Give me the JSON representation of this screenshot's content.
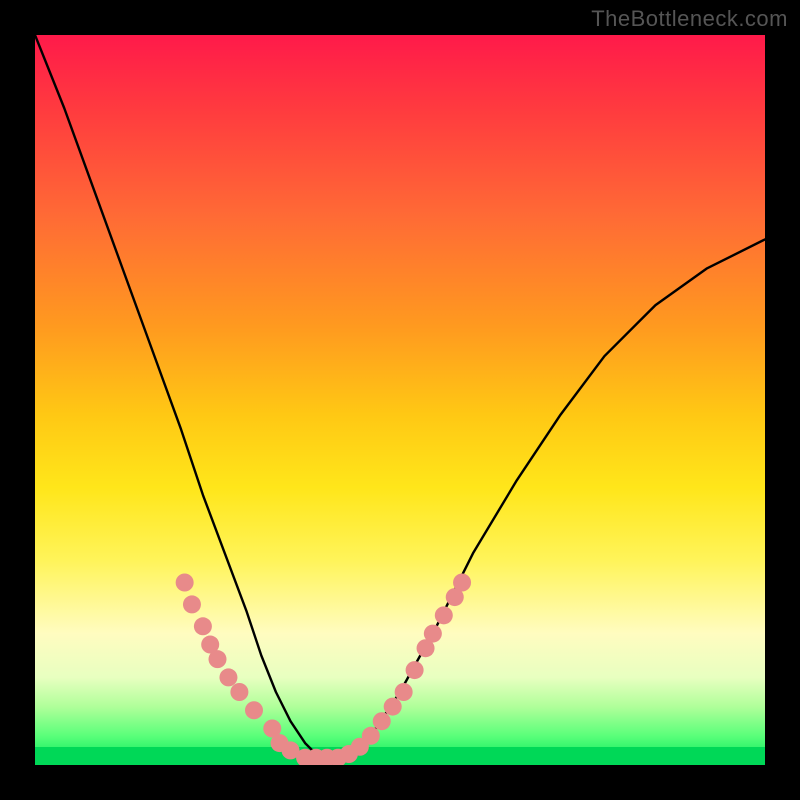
{
  "attribution": "TheBottleneck.com",
  "chart_data": {
    "type": "line",
    "title": "",
    "xlabel": "",
    "ylabel": "",
    "xlim": [
      0,
      100
    ],
    "ylim": [
      0,
      100
    ],
    "grid": false,
    "legend": false,
    "background_gradient": {
      "direction": "vertical",
      "stops": [
        {
          "pos": 0.0,
          "color": "#ff1a4a"
        },
        {
          "pos": 0.1,
          "color": "#ff3a3f"
        },
        {
          "pos": 0.25,
          "color": "#ff6b35"
        },
        {
          "pos": 0.4,
          "color": "#ff9a1f"
        },
        {
          "pos": 0.52,
          "color": "#ffc814"
        },
        {
          "pos": 0.62,
          "color": "#ffe61a"
        },
        {
          "pos": 0.72,
          "color": "#fff45a"
        },
        {
          "pos": 0.82,
          "color": "#fffcc0"
        },
        {
          "pos": 0.88,
          "color": "#e8ffc0"
        },
        {
          "pos": 0.92,
          "color": "#b0ff9a"
        },
        {
          "pos": 0.96,
          "color": "#5aff7a"
        },
        {
          "pos": 1.0,
          "color": "#00e85a"
        }
      ]
    },
    "series": [
      {
        "name": "bottleneck-curve",
        "color": "#000000",
        "x": [
          0,
          4,
          8,
          12,
          16,
          20,
          23,
          26,
          29,
          31,
          33,
          35,
          37,
          39,
          41,
          43,
          46,
          50,
          55,
          60,
          66,
          72,
          78,
          85,
          92,
          100
        ],
        "y": [
          100,
          90,
          79,
          68,
          57,
          46,
          37,
          29,
          21,
          15,
          10,
          6,
          3,
          1,
          0,
          1,
          4,
          10,
          19,
          29,
          39,
          48,
          56,
          63,
          68,
          72
        ]
      }
    ],
    "markers": {
      "name": "highlight-dots",
      "color": "#e88a8a",
      "radius_px": 9,
      "points": [
        {
          "x": 20.5,
          "y": 25
        },
        {
          "x": 21.5,
          "y": 22
        },
        {
          "x": 23.0,
          "y": 19
        },
        {
          "x": 24.0,
          "y": 16.5
        },
        {
          "x": 25.0,
          "y": 14.5
        },
        {
          "x": 26.5,
          "y": 12
        },
        {
          "x": 28.0,
          "y": 10
        },
        {
          "x": 30.0,
          "y": 7.5
        },
        {
          "x": 32.5,
          "y": 5
        },
        {
          "x": 33.5,
          "y": 3
        },
        {
          "x": 35.0,
          "y": 2
        },
        {
          "x": 37.0,
          "y": 1
        },
        {
          "x": 38.5,
          "y": 1
        },
        {
          "x": 40.0,
          "y": 1
        },
        {
          "x": 41.5,
          "y": 1
        },
        {
          "x": 43.0,
          "y": 1.5
        },
        {
          "x": 44.5,
          "y": 2.5
        },
        {
          "x": 46.0,
          "y": 4
        },
        {
          "x": 47.5,
          "y": 6
        },
        {
          "x": 49.0,
          "y": 8
        },
        {
          "x": 50.5,
          "y": 10
        },
        {
          "x": 52.0,
          "y": 13
        },
        {
          "x": 53.5,
          "y": 16
        },
        {
          "x": 54.5,
          "y": 18
        },
        {
          "x": 56.0,
          "y": 20.5
        },
        {
          "x": 57.5,
          "y": 23
        },
        {
          "x": 58.5,
          "y": 25
        }
      ]
    }
  }
}
